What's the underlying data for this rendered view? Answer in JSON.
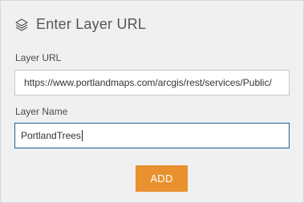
{
  "dialog": {
    "title": "Enter Layer URL",
    "title_icon": "layers-icon"
  },
  "form": {
    "url_label": "Layer URL",
    "url_value": "https://www.portlandmaps.com/arcgis/rest/services/Public/",
    "name_label": "Layer Name",
    "name_value": "PortlandTrees"
  },
  "actions": {
    "add_label": "ADD"
  },
  "colors": {
    "panel_background": "#f0f0f0",
    "add_button": "#e8912e",
    "focused_border": "#1f5f8f"
  }
}
